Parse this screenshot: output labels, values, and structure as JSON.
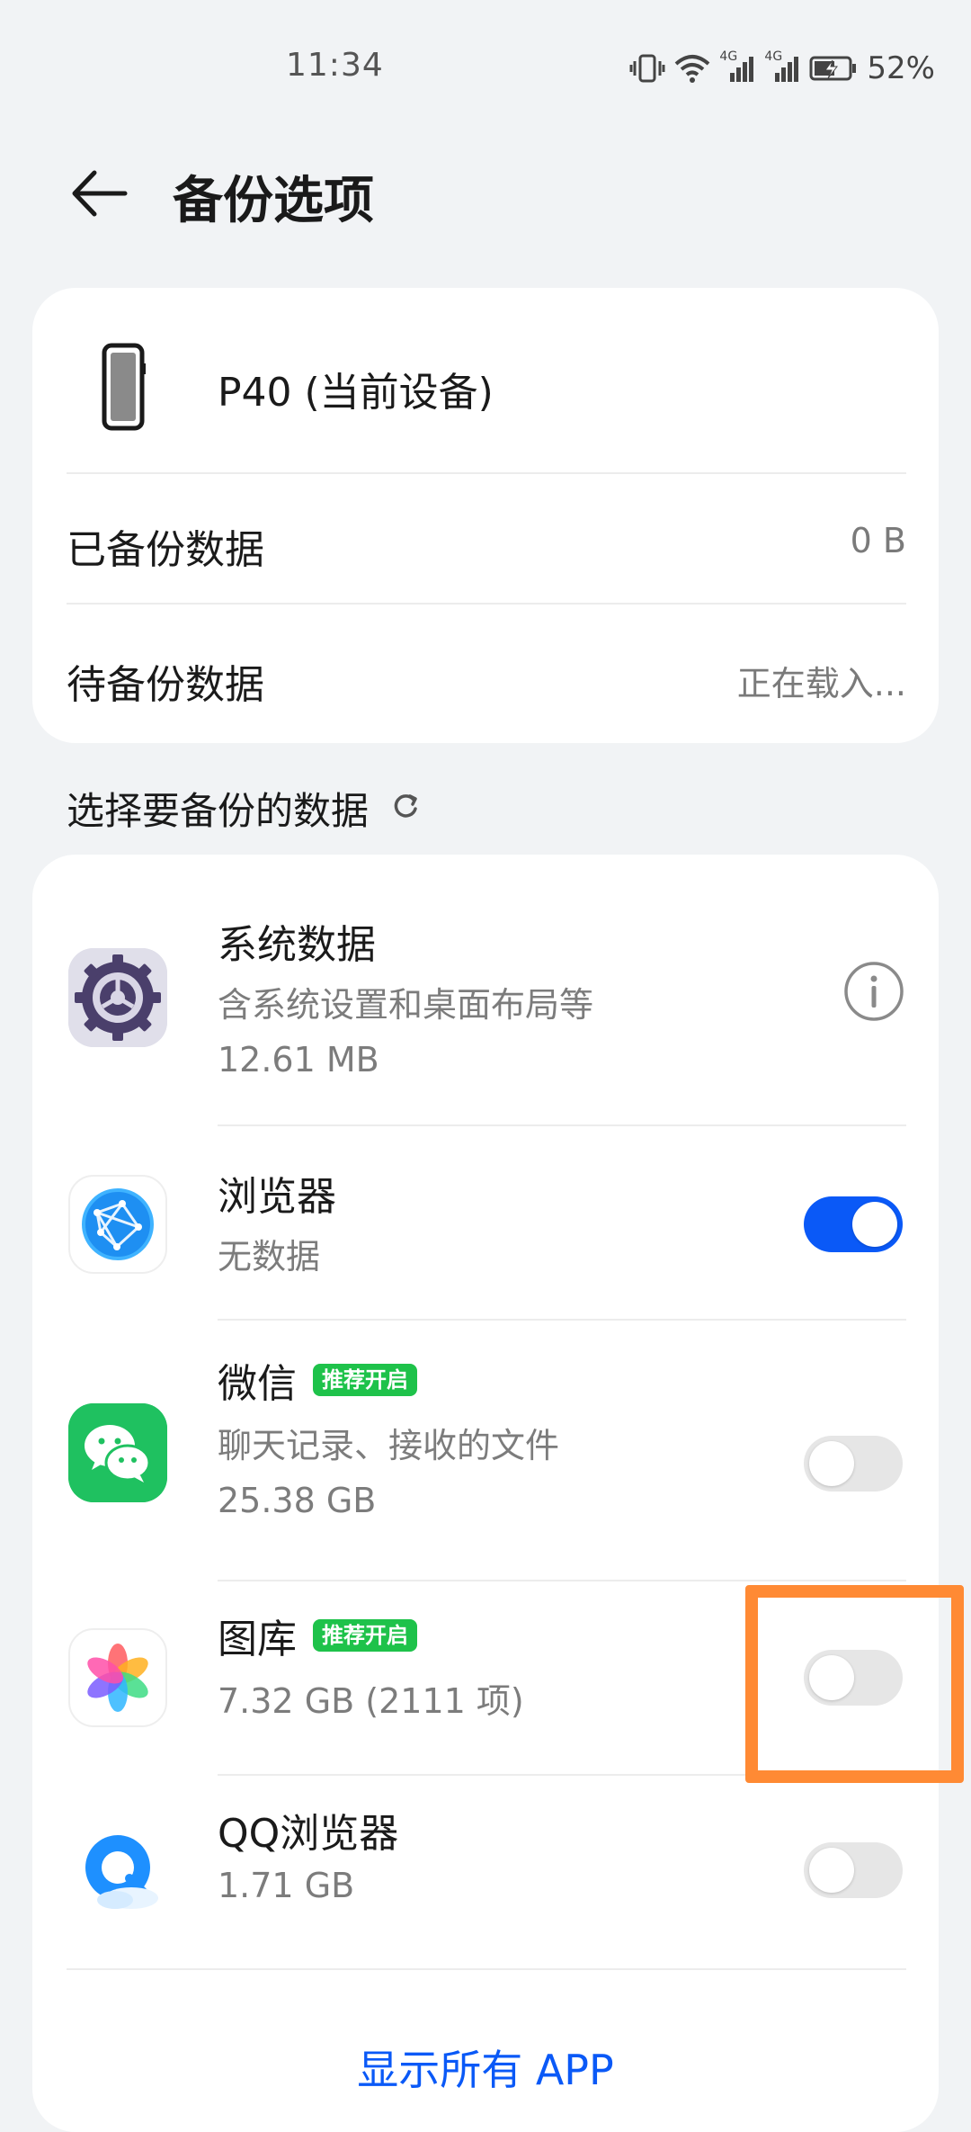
{
  "status_bar": {
    "time": "11:34",
    "network_1": "4G",
    "network_2": "4G",
    "battery": "52%"
  },
  "header": {
    "title": "备份选项",
    "back_icon": "arrow-left-icon"
  },
  "device_card": {
    "device_name": "P40 (当前设备)",
    "backed_up_label": "已备份数据",
    "backed_up_value": "0 B",
    "pending_label": "待备份数据",
    "pending_value": "正在载入..."
  },
  "section": {
    "title": "选择要备份的数据",
    "refresh_icon": "refresh-icon"
  },
  "apps": [
    {
      "name": "系统数据",
      "subtitle": "含系统设置和桌面布局等",
      "size": "12.61 MB",
      "control": "info",
      "icon": "system-settings-icon"
    },
    {
      "name": "浏览器",
      "subtitle": "无数据",
      "control": "toggle",
      "enabled": true,
      "icon": "browser-icon"
    },
    {
      "name": "微信",
      "badge": "推荐开启",
      "subtitle": "聊天记录、接收的文件",
      "size": "25.38 GB",
      "control": "toggle",
      "enabled": false,
      "icon": "wechat-icon"
    },
    {
      "name": "图库",
      "badge": "推荐开启",
      "subtitle": "7.32 GB (2111 项)",
      "control": "toggle",
      "enabled": false,
      "icon": "gallery-icon"
    },
    {
      "name": "QQ浏览器",
      "subtitle": "1.71 GB",
      "control": "toggle",
      "enabled": false,
      "icon": "qq-browser-icon"
    }
  ],
  "show_all_label": "显示所有 APP",
  "colors": {
    "accent": "#0a59f7",
    "badge": "#1ec24a",
    "highlight": "#ff8a34",
    "background": "#f1f3f5"
  }
}
